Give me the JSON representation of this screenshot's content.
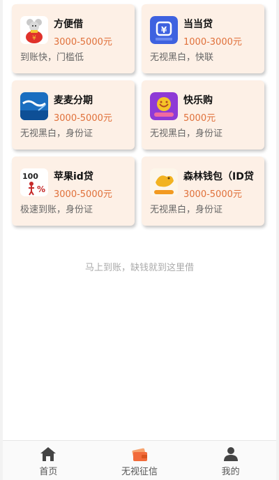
{
  "products": [
    {
      "name": "方便借",
      "amount": "3000-5000元",
      "desc": "到账快，门槛低",
      "icon": "mouse-moneybag-icon"
    },
    {
      "name": "当当贷",
      "amount": "1000-3000元",
      "desc": "无视黑白，快联",
      "icon": "blue-dai-icon"
    },
    {
      "name": "麦麦分期",
      "amount": "3000-5000元",
      "desc": "无视黑白，身份证",
      "icon": "haidai-logo-icon"
    },
    {
      "name": "快乐购",
      "amount": "5000元",
      "desc": "无视黑白，身份证",
      "icon": "purple-star-icon"
    },
    {
      "name": "苹果id贷",
      "amount": "3000-5000元",
      "desc": "极速到账，身份证",
      "icon": "hundred-percent-icon"
    },
    {
      "name": "森林钱包（ID贷",
      "amount": "3000-5000元",
      "desc": "无视黑白，身份证",
      "icon": "golden-bird-icon"
    }
  ],
  "tagline": "马上到账，缺钱就到这里借",
  "tabs": [
    {
      "label": "首页",
      "icon": "home-icon"
    },
    {
      "label": "无视征信",
      "icon": "wallet-icon"
    },
    {
      "label": "我的",
      "icon": "user-icon"
    }
  ],
  "colors": {
    "card_bg": "#fdf0e6",
    "amount": "#e0703a",
    "active_tab": "#f26b3a"
  }
}
